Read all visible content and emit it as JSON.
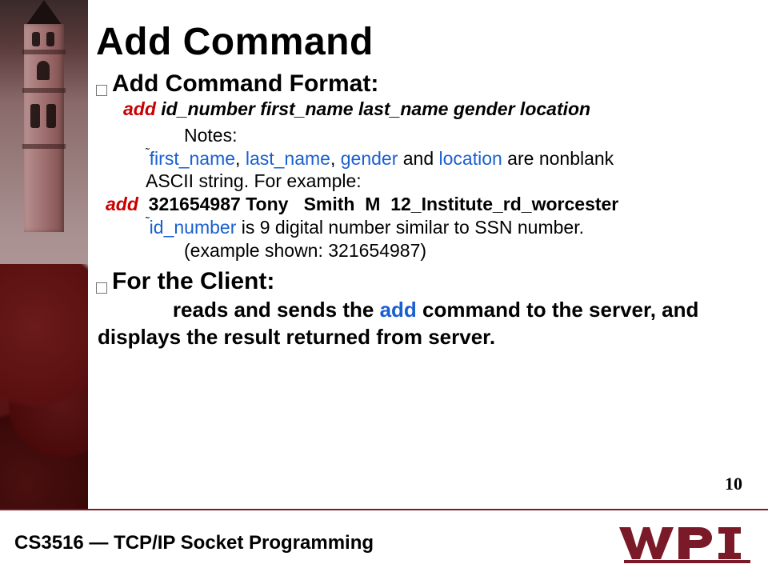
{
  "title": "Add Command",
  "sections": {
    "format": {
      "heading": "Add Command Format:",
      "syntax_cmd": "add",
      "syntax_args": "id_number first_name last_name gender location",
      "notes_label": "Notes:",
      "rule1_pre_sup": "˜",
      "rule1_k1": "first_name",
      "rule1_c1": ", ",
      "rule1_k2": "last_name",
      "rule1_c2": ", ",
      "rule1_k3": "gender",
      "rule1_mid": " and ",
      "rule1_k4": "location",
      "rule1_tail": " are nonblank",
      "rule1_line2": "ASCII string. For example:",
      "example_cmd": "add",
      "example_rest": "  321654987 Tony   Smith  M  12_Institute_rd_worcester",
      "rule2_pre_sup": "˜",
      "rule2_k": "id_number",
      "rule2_tail": " is 9 digital number similar to SSN number.",
      "rule2_line2": "(example shown: 321654987)"
    },
    "client": {
      "heading": "For the Client:",
      "body_lead_spaces": "             ",
      "body_pre": "reads and sends the ",
      "body_kw": "add",
      "body_post": " command to the server, and displays the result returned from server."
    }
  },
  "page_number": "10",
  "footer": "CS3516 — TCP/IP Socket Programming",
  "logo_text": "WPI"
}
